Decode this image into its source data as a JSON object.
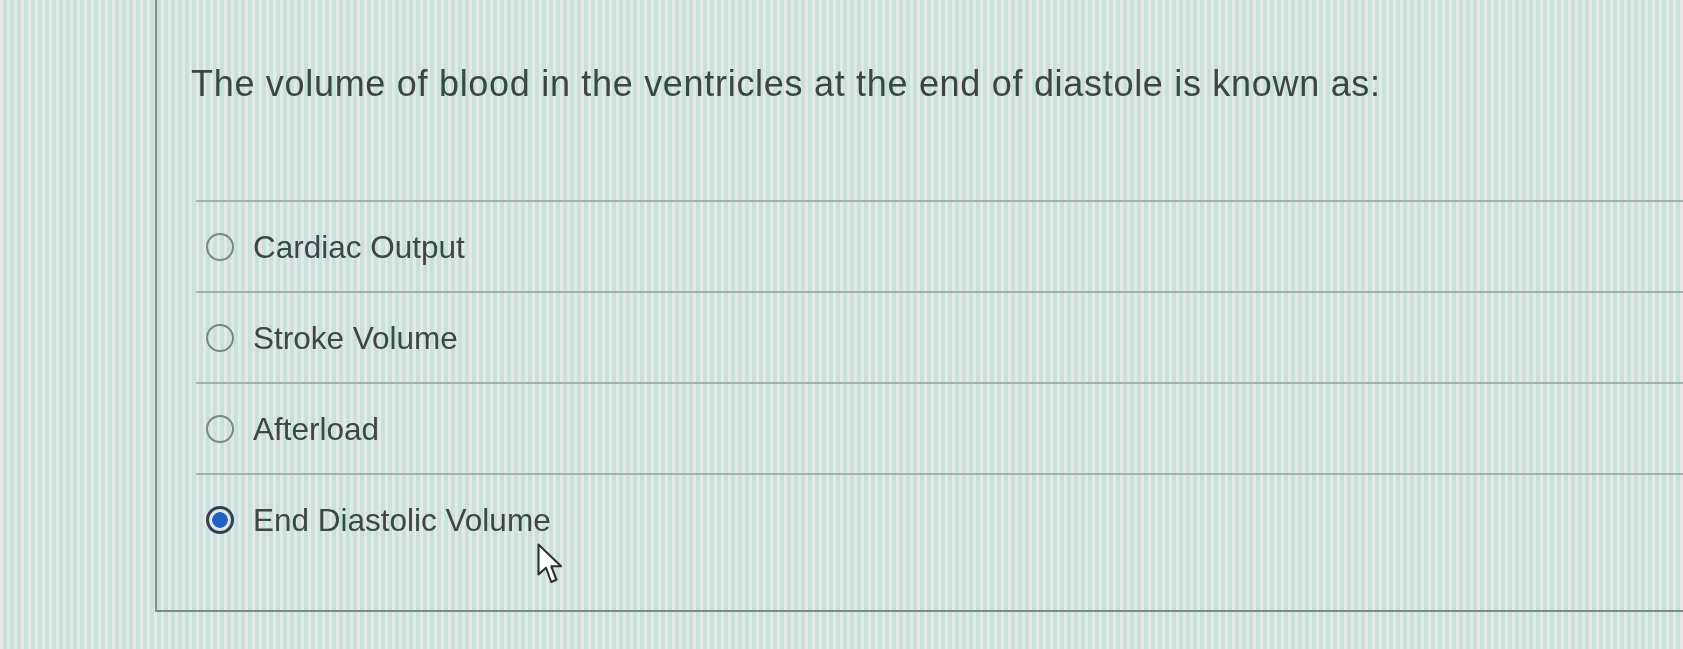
{
  "question": {
    "text": "The volume of blood in the ventricles at the end of diastole is known as:"
  },
  "options": [
    {
      "label": "Cardiac Output",
      "selected": false
    },
    {
      "label": "Stroke Volume",
      "selected": false
    },
    {
      "label": "Afterload",
      "selected": false
    },
    {
      "label": "End Diastolic Volume",
      "selected": true
    }
  ]
}
